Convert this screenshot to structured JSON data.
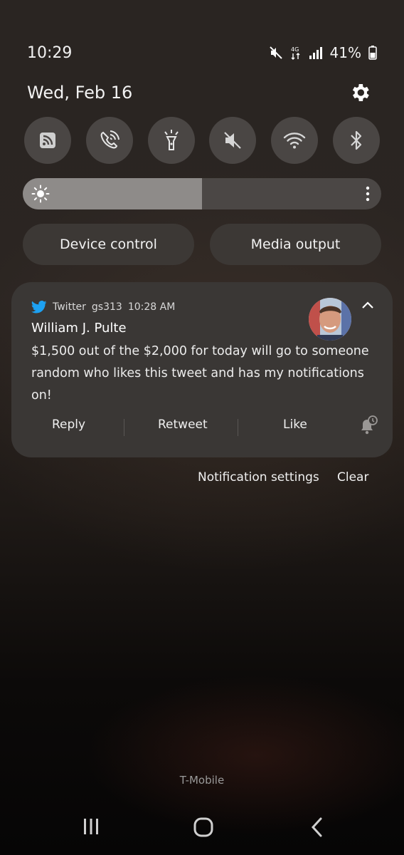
{
  "status_bar": {
    "time": "10:29",
    "battery_percent": "41%",
    "network_label": "4G"
  },
  "header": {
    "date": "Wed, Feb 16"
  },
  "quick_toggles": [
    {
      "icon": "rss-icon"
    },
    {
      "icon": "wifi-calling-icon"
    },
    {
      "icon": "flashlight-icon"
    },
    {
      "icon": "mute-icon"
    },
    {
      "icon": "wifi-icon"
    },
    {
      "icon": "bluetooth-icon"
    }
  ],
  "brightness": {
    "level": 0.5
  },
  "buttons": {
    "device_control": "Device control",
    "media_output": "Media output"
  },
  "notification": {
    "app": "Twitter",
    "account": "gs313",
    "time": "10:28 AM",
    "title": "William J. Pulte",
    "body": "$1,500 out of the $2,000 for today will go to someone random who likes this tweet and has my notifications on!",
    "actions": {
      "reply": "Reply",
      "retweet": "Retweet",
      "like": "Like"
    }
  },
  "footer_links": {
    "settings": "Notification settings",
    "clear": "Clear"
  },
  "carrier": "T-Mobile",
  "colors": {
    "twitter_blue": "#1da1f2",
    "card": "#3a3735",
    "toggle": "#4a4644"
  }
}
